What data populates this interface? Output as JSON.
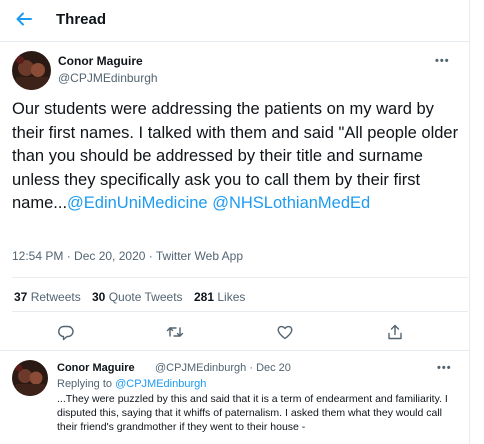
{
  "header": {
    "title": "Thread"
  },
  "tweet": {
    "author_name": "Conor Maguire",
    "author_handle": "@CPJMEdinburgh",
    "more": "•••",
    "text_plain": "Our students were addressing the patients on my ward by their first names. I talked with them and said \"All people older than you should be addressed by their title and surname unless they specifically ask you to call them by their first name...",
    "mention_1": "@EdinUniMedicine",
    "mention_2": "@NHSLothianMedEd",
    "meta": "12:54 PM · Dec 20, 2020 · Twitter Web App",
    "retweets_count": "37",
    "retweets_label": "Retweets",
    "quotes_count": "30",
    "quotes_label": "Quote Tweets",
    "likes_count": "281",
    "likes_label": "Likes"
  },
  "icons": {
    "back": "arrow-left-icon",
    "reply": "reply-icon",
    "retweet": "retweet-icon",
    "like": "heart-icon",
    "share": "share-icon"
  },
  "reply": {
    "author_name": "Conor Maguire",
    "author_handle": "@CPJMEdinburgh",
    "dot": "·",
    "date": "Dec 20",
    "more": "•••",
    "replying_to_label": "Replying to",
    "replying_to_handle": "@CPJMEdinburgh",
    "text": "...They were puzzled by this and said that it is a term of endearment and familiarity. I disputed this, saying that it whiffs of paternalism. I asked them what they would call their friend's grandmother if they went to their house -"
  },
  "colors": {
    "accent": "#1d9bf0",
    "muted": "#536471",
    "text": "#0f1419",
    "divider": "#e6ecf0"
  }
}
